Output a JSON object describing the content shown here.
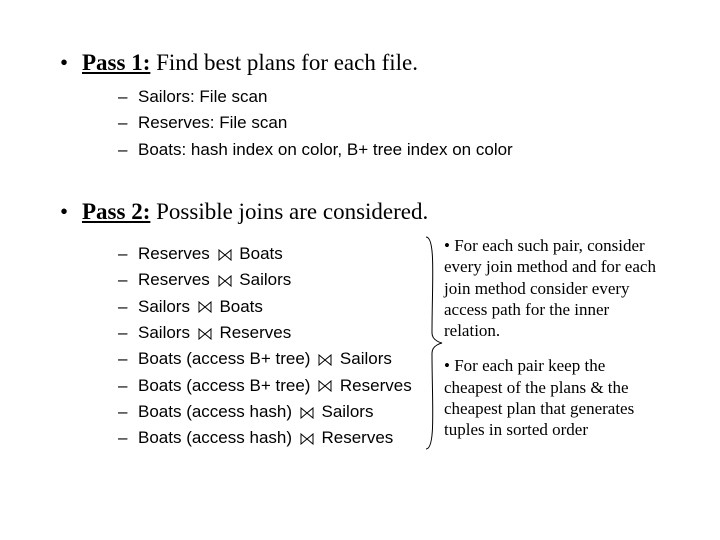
{
  "pass1": {
    "label_bold": "Pass 1:",
    "label_rest": " Find best plans for each file.",
    "items": [
      "Sailors: File scan",
      "Reserves: File scan",
      "Boats: hash index on color, B+ tree index on color"
    ]
  },
  "pass2": {
    "label_bold": "Pass 2:",
    "label_rest": " Possible joins are considered.",
    "joins": [
      {
        "left": "Reserves",
        "right": "Boats"
      },
      {
        "left": "Reserves",
        "right": "Sailors"
      },
      {
        "left": "Sailors",
        "right": "Boats"
      },
      {
        "left": "Sailors",
        "right": "Reserves"
      },
      {
        "left": "Boats (access B+ tree)",
        "right": "Sailors"
      },
      {
        "left": "Boats (access B+ tree)",
        "right": "Reserves"
      },
      {
        "left": "Boats (access hash)",
        "right": "Sailors"
      },
      {
        "left": "Boats (access hash)",
        "right": "Reserves"
      }
    ]
  },
  "notes": {
    "n1": "For each such pair, consider every join method and for each join method consider every access path for the inner relation.",
    "n2": "For each pair keep the cheapest of the plans & the cheapest plan that generates tuples in sorted order"
  }
}
